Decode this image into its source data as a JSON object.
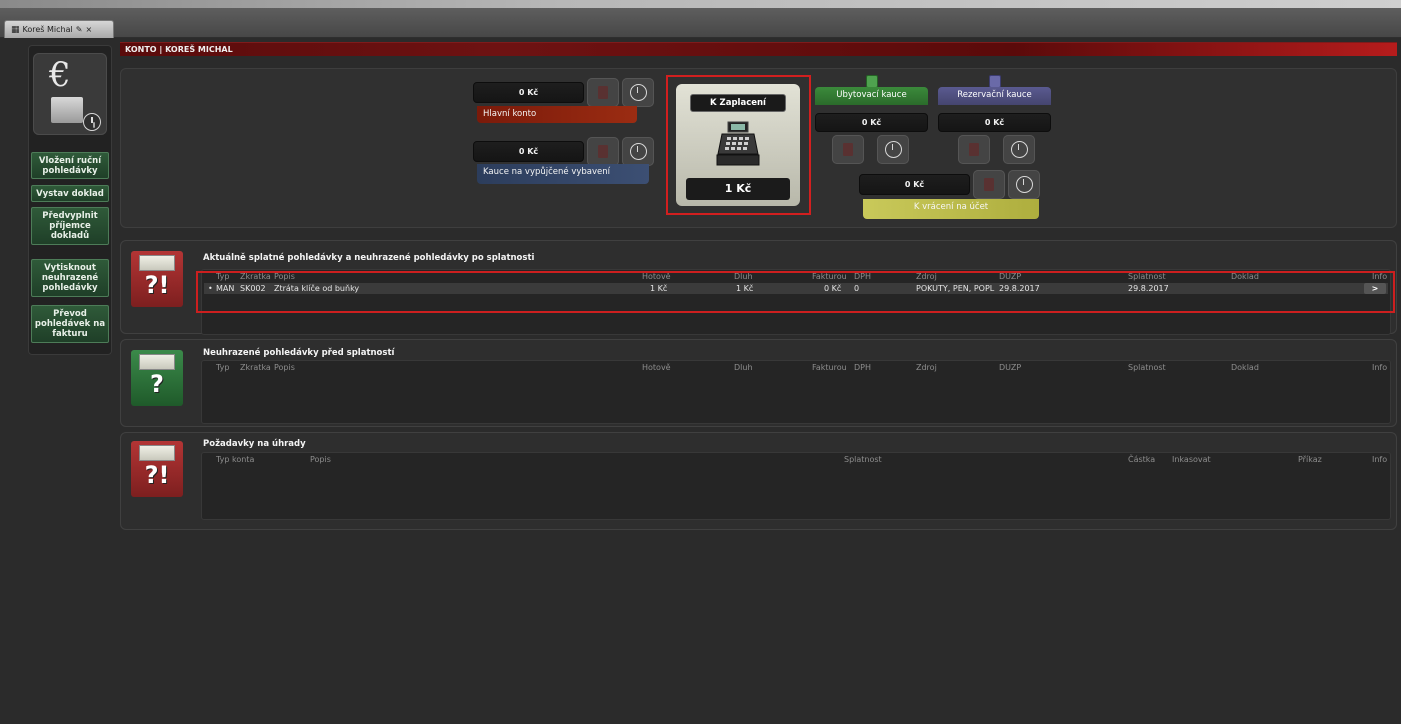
{
  "tab": {
    "title": "Koreš Michal"
  },
  "header": {
    "breadcrumb": "KONTO | KOREŠ MICHAL"
  },
  "sidebar": {
    "buttons": [
      {
        "label": "Vložení ruční pohledávky"
      },
      {
        "label": "Vystav doklad"
      },
      {
        "label": "Předvyplnit příjemce dokladů"
      },
      {
        "label": "Vytisknout neuhrazené pohledávky"
      },
      {
        "label": "Převod pohledávek na fakturu"
      }
    ]
  },
  "accounts": {
    "main": {
      "amount": "0 Kč",
      "label": "Hlavní konto"
    },
    "deposit": {
      "amount": "0 Kč",
      "label": "Kauce na vypůjčené vybavení"
    },
    "to_pay": {
      "title": "K Zaplacení",
      "amount": "1 Kč"
    },
    "accommodation": {
      "title": "Ubytovací kauce",
      "amount": "0 Kč"
    },
    "reservation": {
      "title": "Rezervační kauce",
      "amount": "0 Kč"
    },
    "refund": {
      "amount": "0 Kč",
      "label": "K vrácení na účet"
    }
  },
  "section_due": {
    "title": "Aktuálně splatné pohledávky a neuhrazené pohledávky po splatnosti",
    "columns": [
      "Typ",
      "Zkratka",
      "Popis",
      "Hotově",
      "Dluh",
      "Fakturou",
      "DPH",
      "Zdroj",
      "DUZP",
      "Splatnost",
      "Doklad",
      "Info"
    ],
    "rows": [
      {
        "bullet": "•",
        "typ": "MAN",
        "zkratka": "SK002",
        "popis": "Ztráta klíče od buňky",
        "hotove": "1 Kč",
        "dluh": "1 Kč",
        "fakturou": "0 Kč",
        "dph": "0",
        "zdroj": "POKUTY, PEN, POPL",
        "duzp": "29.8.2017",
        "splatnost": "29.8.2017",
        "doklad": "",
        "info": ">"
      }
    ]
  },
  "section_notdue": {
    "title": "Neuhrazené pohledávky před splatností",
    "columns": [
      "Typ",
      "Zkratka",
      "Popis",
      "Hotově",
      "Dluh",
      "Fakturou",
      "DPH",
      "Zdroj",
      "DUZP",
      "Splatnost",
      "Doklad",
      "Info"
    ]
  },
  "section_requests": {
    "title": "Požadavky na úhrady",
    "columns": [
      "Typ konta",
      "Popis",
      "Splatnost",
      "Částka",
      "Inkasovat",
      "Příkaz",
      "Info"
    ]
  },
  "colors": {
    "accent_red": "#d21f1f",
    "green_button": "#2f5a39",
    "accommodation_green": "#2f6b2f",
    "reservation_purple": "#4a4a78",
    "refund_yellow": "#b9b94a",
    "main_account_red": "#7a1a0a"
  }
}
